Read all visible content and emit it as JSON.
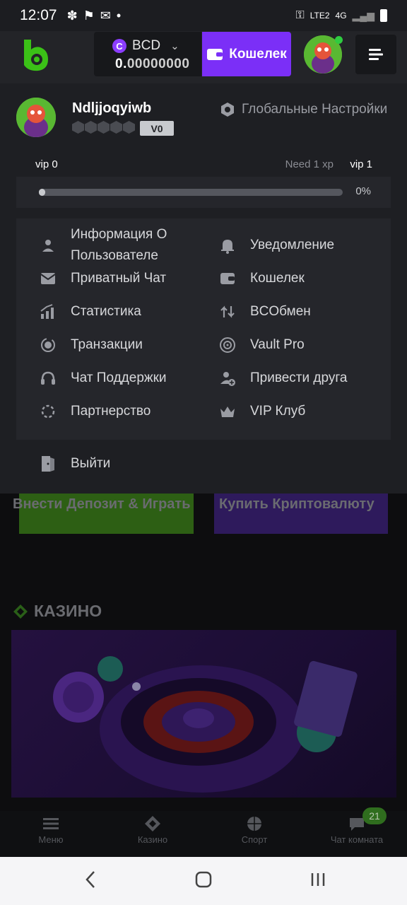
{
  "status_bar": {
    "time": "12:07",
    "network_label": "LTE2",
    "net_type": "4G"
  },
  "header": {
    "currency": "BCD",
    "balance_integer": "0.",
    "balance_decimals": "00000000",
    "wallet_button": "Кошелек"
  },
  "profile": {
    "username": "Ndljjoqyiwb",
    "vip_badge": "V0",
    "global_settings": "Глобальные Настройки",
    "vip_current": "vip 0",
    "need_xp": "Need 1 xp",
    "vip_next": "vip 1",
    "progress_fraction": 0.0,
    "progress_text": "0%"
  },
  "menu": {
    "left": [
      {
        "label": "Информация О Пользователе",
        "icon": "user-icon"
      },
      {
        "label": "Приватный Чат",
        "icon": "mail-icon"
      },
      {
        "label": "Статистика",
        "icon": "stats-icon"
      },
      {
        "label": "Транзакции",
        "icon": "transactions-icon"
      },
      {
        "label": "Чат Поддержки",
        "icon": "headset-icon"
      },
      {
        "label": "Партнерство",
        "icon": "partnership-icon"
      }
    ],
    "right": [
      {
        "label": "Уведомление",
        "icon": "bell-icon"
      },
      {
        "label": "Кошелек",
        "icon": "wallet-icon"
      },
      {
        "label": "BCОбмен",
        "icon": "exchange-icon"
      },
      {
        "label": "Vault Pro",
        "icon": "vault-icon"
      },
      {
        "label": "Привести друга",
        "icon": "add-friend-icon"
      },
      {
        "label": "VIP Клуб",
        "icon": "crown-icon"
      }
    ],
    "logout": "Выйти"
  },
  "page_behind": {
    "deposit_button": "Внести Депозит & Играть",
    "buy_crypto_button": "Купить Криптовалюту",
    "casino_title": "КАЗИНО"
  },
  "bottom_nav": {
    "items": [
      "Меню",
      "Казино",
      "Спорт",
      "Чат комната"
    ],
    "chat_badge": "21"
  },
  "colors": {
    "accent_purple": "#7b2ff7",
    "brand_green": "#3bc117",
    "panel_bg": "#1e1f23"
  }
}
